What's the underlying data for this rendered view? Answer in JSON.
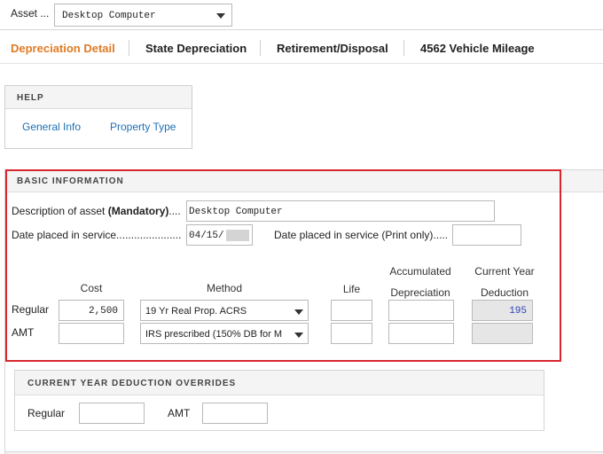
{
  "asset": {
    "label": "Asset ...",
    "selected": "Desktop Computer"
  },
  "tabs": [
    {
      "label": "Depreciation Detail",
      "active": true
    },
    {
      "label": "State Depreciation",
      "active": false
    },
    {
      "label": "Retirement/Disposal",
      "active": false
    },
    {
      "label": "4562 Vehicle Mileage",
      "active": false
    }
  ],
  "help": {
    "title": "HELP",
    "links": [
      "General Info",
      "Property Type"
    ]
  },
  "basic": {
    "title": "BASIC INFORMATION",
    "description_label": "Description of asset ",
    "description_mandatory": "(Mandatory)",
    "description_dots": "....",
    "description_value": "Desktop Computer",
    "date_label": "Date placed in service......................",
    "date_value": "04/15/",
    "date_print_label": "Date placed in service (Print only).....",
    "date_print_value": "",
    "columns": {
      "cost": "Cost",
      "method": "Method",
      "life": "Life",
      "accum_line1": "Accumulated",
      "accum_line2": "Depreciation",
      "cy_line1": "Current Year",
      "cy_line2": "Deduction"
    },
    "rows": [
      {
        "label": "Regular",
        "cost": "2,500",
        "method": "19 Yr Real Prop. ACRS",
        "life": "",
        "accum": "",
        "deduction": "195"
      },
      {
        "label": "AMT",
        "cost": "",
        "method": "IRS prescribed (150% DB for M",
        "life": "",
        "accum": "",
        "deduction": ""
      }
    ]
  },
  "overrides": {
    "title": "CURRENT YEAR DEDUCTION OVERRIDES",
    "regular_label": "Regular",
    "regular_value": "",
    "amt_label": "AMT",
    "amt_value": ""
  },
  "colors": {
    "accent": "#e07b24",
    "link": "#1f6fb2",
    "highlight": "#d9262e",
    "value_blue": "#2b3fb8"
  }
}
